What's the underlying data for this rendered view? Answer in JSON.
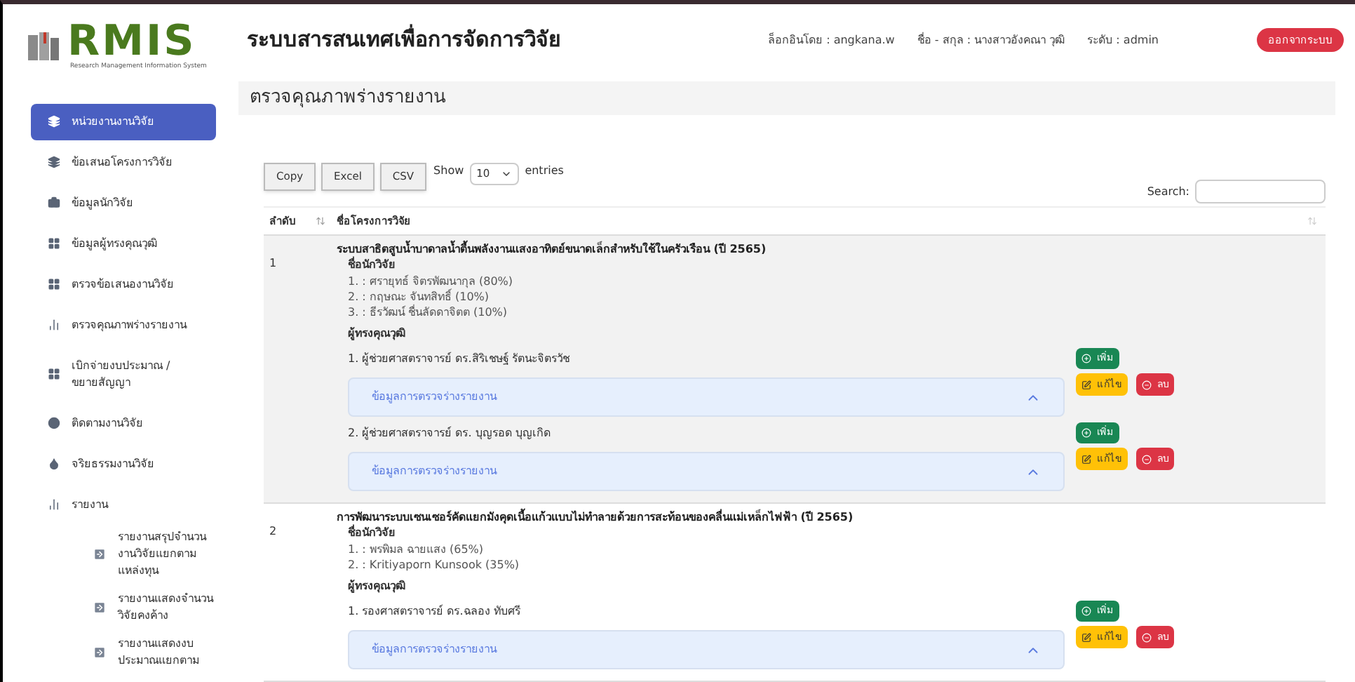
{
  "logo": {
    "name": "RMIS",
    "subtitle": "Research Management Information System"
  },
  "header": {
    "title": "ระบบสารสนเทศเพื่อการจัดการวิจัย",
    "user_info": [
      "ล็อกอินโดย : angkana.w",
      "ชื่อ - สกุล : นางสาวอังคณา วุฒิ",
      "ระดับ : admin"
    ],
    "logout": "ออกจากระบบ"
  },
  "sidebar": {
    "items": [
      {
        "label": "หน่วยงานงานวิจัย",
        "selected": true
      },
      {
        "label": "ข้อเสนอโครงการวิจัย",
        "selected": false
      },
      {
        "label": "ข้อมูลนักวิจัย",
        "selected": false
      },
      {
        "label": "ข้อมูลผู้ทรงคุณวุฒิ",
        "selected": false
      },
      {
        "label": "ตรวจข้อเสนองานวิจัย",
        "selected": false
      },
      {
        "label": "ตรวจคุณภาพร่างรายงาน",
        "selected": false
      },
      {
        "label": "เบิกจ่ายงบประมาณ / ขยายสัญญา",
        "selected": false
      },
      {
        "label": "ติดตามงานวิจัย",
        "selected": false
      },
      {
        "label": "จริยธรรมงานวิจัย",
        "selected": false
      },
      {
        "label": "รายงาน",
        "selected": false,
        "children": [
          {
            "label": "รายงานสรุปจำนวนงานวิจัยแยกตามแหล่งทุน",
            "selected": false
          },
          {
            "label": "รายงานแสดงจำนวนวิจัยคงค้าง",
            "selected": false
          },
          {
            "label": "รายงานแสดงงบประมาณแยกตาม",
            "selected": false
          }
        ]
      }
    ]
  },
  "page_title": "ตรวจคุณภาพร่างรายงาน",
  "toolbar": {
    "buttons": [
      "Copy",
      "Excel",
      "CSV"
    ],
    "show_label": "Show",
    "page_size": "10",
    "entries_label": "entries",
    "search_label": "Search:"
  },
  "table": {
    "columns": [
      "ลำดับ",
      "ชื่อโครงการวิจัย"
    ],
    "rows": [
      {
        "number": "1",
        "title": "ระบบสาธิตสูบน้ำบาดาลน้ำตื้นพลังงานแสงอาทิตย์ขนาดเล็กสำหรับใช้ในครัวเรือน (ปี 2565)",
        "researchers_label": "ชื่อนักวิจัย",
        "researchers": [
          "1. : ศรายุทธ์ จิตรพัฒนากุล (80%)",
          "2. : กฤษณะ จันทสิทธิ์ (10%)",
          "3. : ธีรวัฒน์ ชื่นลัดดาจิตต (10%)"
        ],
        "experts_label": "ผู้ทรงคุณวุฒิ",
        "experts": [
          {
            "name": "1. ผู้ช่วยศาสตราจารย์ ดร.สิริเชษฐ์ รัตนะจิตรวัช",
            "panel": "ข้อมูลการตรวจร่างรายงาน",
            "expanded": true,
            "add": "เพิ่ม",
            "edit": "แก้ไข",
            "delete": "ลบ"
          },
          {
            "name": "2. ผู้ช่วยศาสตราจารย์ ดร. บุญรอด บุญเกิด",
            "panel": "ข้อมูลการตรวจร่างรายงาน",
            "expanded": true,
            "add": "เพิ่ม",
            "edit": "แก้ไข",
            "delete": "ลบ"
          }
        ]
      },
      {
        "number": "2",
        "title": "การพัฒนาระบบเซนเซอร์คัดแยกมังคุดเนื้อแก้วแบบไม่ทำลายด้วยการสะท้อนของคลื่นแม่เหล็กไฟฟ้า (ปี 2565)",
        "researchers_label": "ชื่อนักวิจัย",
        "researchers": [
          "1. : พรพิมล ฉายแสง (65%)",
          "2. : Kritiyaporn Kunsook (35%)"
        ],
        "experts_label": "ผู้ทรงคุณวุฒิ",
        "experts": [
          {
            "name": "1. รองศาสตราจารย์ ดร.ฉลอง ทับศรี",
            "panel": "ข้อมูลการตรวจร่างรายงาน",
            "expanded": true,
            "add": "เพิ่ม",
            "edit": "แก้ไข",
            "delete": "ลบ"
          }
        ]
      }
    ]
  }
}
